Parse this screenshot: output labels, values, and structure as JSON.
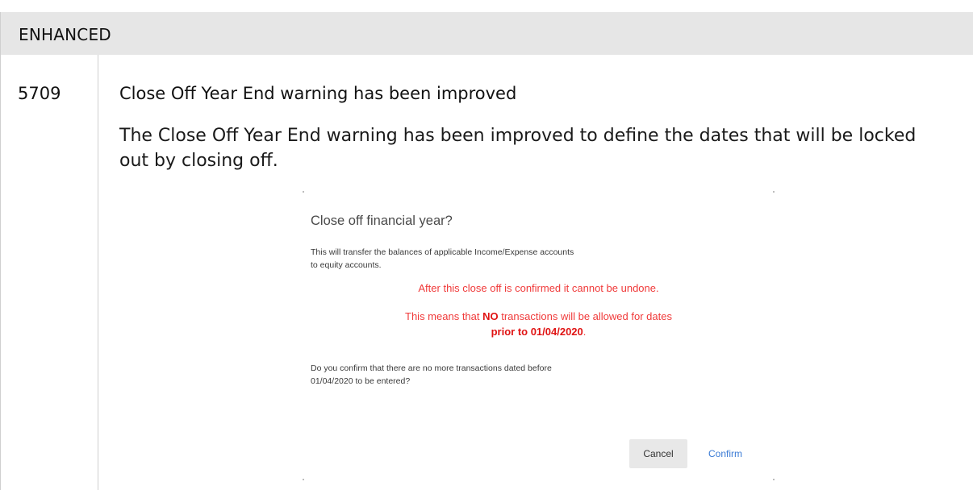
{
  "section": {
    "label": "ENHANCED"
  },
  "entry": {
    "id": "5709",
    "title": "Close Off Year End warning has been improved",
    "description": "The Close Off Year End warning has been improved to define the dates that will be locked out by closing off."
  },
  "dialog": {
    "title": "Close off financial year?",
    "intro": "This will transfer the balances of applicable Income/Expense accounts to equity accounts.",
    "warning1": "After this close off is confirmed it cannot be undone.",
    "warning2_before": "This means that ",
    "warning2_bold": "NO",
    "warning2_after": " transactions will be allowed for dates",
    "warning3_bold": "prior to 01/04/2020",
    "warning3_after": ".",
    "question": "Do you confirm that there are no more transactions dated before 01/04/2020 to be entered?",
    "cancel_label": "Cancel",
    "confirm_label": "Confirm",
    "warning_color": "#f03a3a",
    "confirm_color": "#3a7bd5"
  }
}
